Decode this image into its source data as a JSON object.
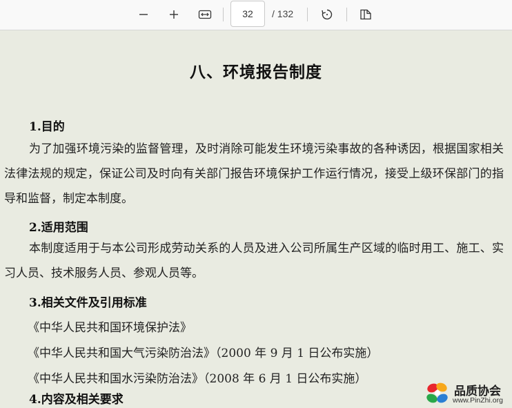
{
  "toolbar": {
    "zoom_out_icon": "minus-icon",
    "zoom_in_icon": "plus-icon",
    "fit_width_icon": "fit-width-icon",
    "current_page": "32",
    "page_total": "/ 132",
    "rotate_icon": "rotate-icon",
    "page_view_icon": "page-view-icon"
  },
  "document": {
    "title": "八、环境报告制度",
    "sections": [
      {
        "heading": "1.目的",
        "paragraph": "为了加强环境污染的监督管理，及时消除可能发生环境污染事故的各种诱因，根据国家相关法律法规的规定，保证公司及时向有关部门报告环境保护工作运行情况，接受上级环保部门的指导和监督，制定本制度。"
      },
      {
        "heading": "2.适用范围",
        "paragraph": "本制度适用于与本公司形成劳动关系的人员及进入公司所属生产区域的临时用工、施工、实习人员、技术服务人员、参观人员等。"
      },
      {
        "heading": "3.相关文件及引用标准",
        "references": [
          "《中华人民共和国环境保护法》",
          "《中华人民共和国大气污染防治法》（2000 年 9 月 1 日公布实施）",
          "《中华人民共和国水污染防治法》（2008 年 6 月 1 日公布实施）"
        ]
      },
      {
        "heading": "4.内容及相关要求"
      }
    ]
  },
  "watermark": {
    "name": "品质协会",
    "url": "www.PinZhi.org",
    "colors": [
      "#e8262d",
      "#f7a81b",
      "#2aa84a",
      "#2a7fd4"
    ]
  }
}
